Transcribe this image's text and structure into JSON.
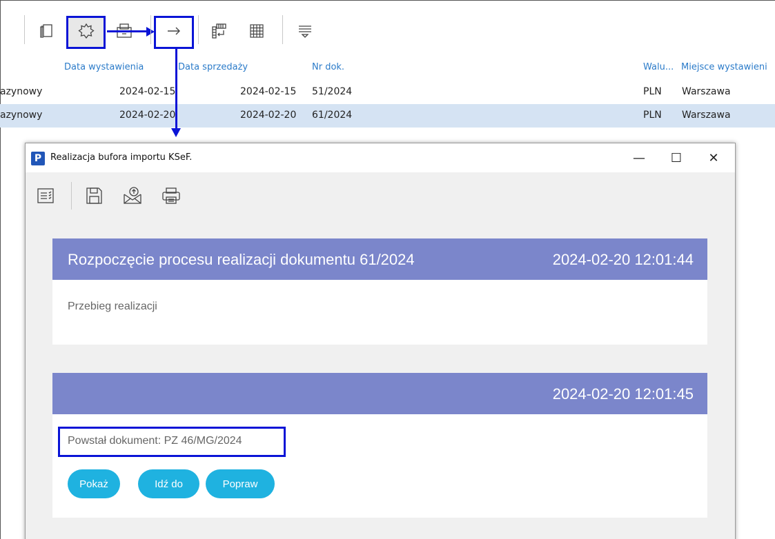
{
  "toolbar": {
    "icons": [
      "copy-icon",
      "gear-icon",
      "receipt-print-icon",
      "arrow-right-icon",
      "column-layout-icon",
      "grid-icon",
      "filter-lines-icon"
    ]
  },
  "grid": {
    "columns": {
      "issue_date": "Data wystawienia",
      "sale_date": "Data sprzedaży",
      "doc_no": "Nr dok.",
      "currency": "Walu...",
      "place": "Miejsce wystawieni"
    },
    "rows": [
      {
        "type": "azynowy",
        "issue_date": "2024-02-15",
        "sale_date": "2024-02-15",
        "doc_no": "51/2024",
        "currency": "PLN",
        "place": "Warszawa"
      },
      {
        "type": "azynowy",
        "issue_date": "2024-02-20",
        "sale_date": "2024-02-20",
        "doc_no": "61/2024",
        "currency": "PLN",
        "place": "Warszawa"
      }
    ]
  },
  "dialog": {
    "logo": "P",
    "title": "Realizacja bufora importu KSeF.",
    "window_controls": {
      "minimize": "—",
      "maximize": "☐",
      "close": "✕"
    },
    "card1": {
      "title": "Rozpoczęcie procesu realizacji dokumentu 61/2024",
      "time": "2024-02-20 12:01:44",
      "text": "Przebieg realizacji"
    },
    "card2": {
      "title": "",
      "time": "2024-02-20 12:01:45",
      "text": "Powstał dokument: PZ 46/MG/2024",
      "buttons": {
        "show": "Pokaż",
        "goto": "Idź do",
        "fix": "Popraw"
      }
    }
  },
  "colors": {
    "highlight": "#0a14d6",
    "card_header": "#7b86cb",
    "pill": "#1fb2e0",
    "selected_row": "#d5e3f3",
    "column_header": "#2b7bc9"
  }
}
